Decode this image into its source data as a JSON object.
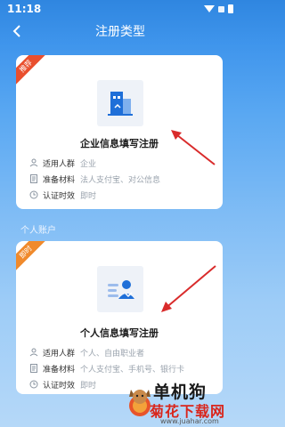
{
  "status_bar": {
    "time": "11:18"
  },
  "header": {
    "title": "注册类型"
  },
  "company_card": {
    "ribbon": "推荐",
    "title": "企业信息填写注册",
    "rows": [
      {
        "label": "适用人群",
        "value": "企业"
      },
      {
        "label": "准备材料",
        "value": "法人支付宝、对公信息"
      },
      {
        "label": "认证时效",
        "value": "即时"
      }
    ]
  },
  "section": {
    "personal_label": "个人账户"
  },
  "personal_card": {
    "ribbon": "即时",
    "title": "个人信息填写注册",
    "rows": [
      {
        "label": "适用人群",
        "value": "个人、自由职业者"
      },
      {
        "label": "准备材料",
        "value": "个人支付宝、手机号、银行卡"
      },
      {
        "label": "认证时效",
        "value": "即时"
      }
    ]
  },
  "watermark": {
    "line1": "单机狗",
    "line2": "菊花下载网",
    "url": "www.juahar.com"
  },
  "colors": {
    "accent": "#2f86e0",
    "icon_blue": "#1f6fd8",
    "arrow_red": "#d92b2b",
    "ribbon_red": "#e94f2e",
    "ribbon_orange": "#f08a2c"
  }
}
